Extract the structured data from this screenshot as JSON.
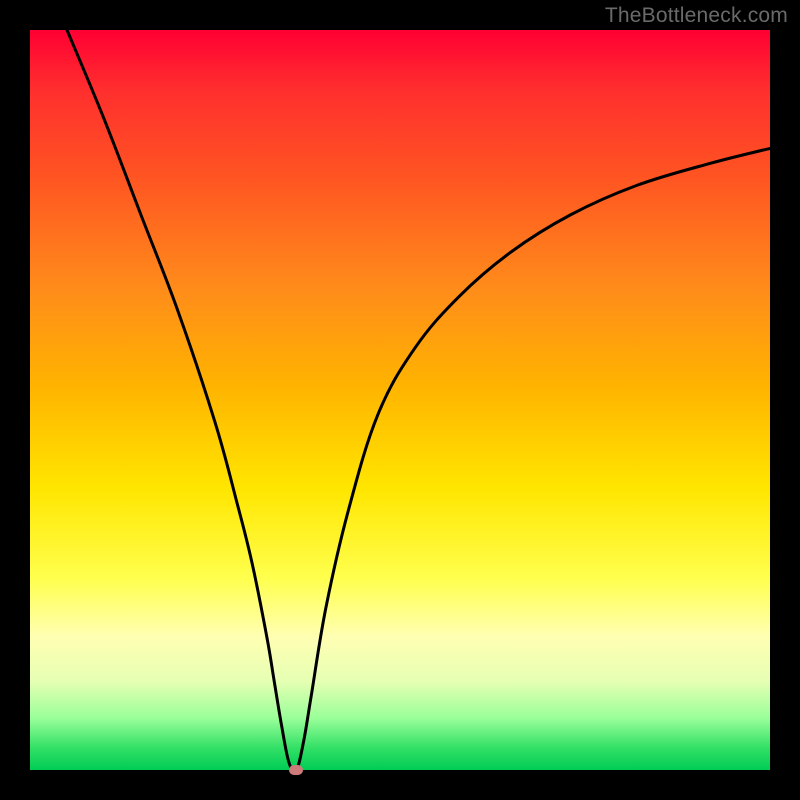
{
  "attribution": "TheBottleneck.com",
  "chart_data": {
    "type": "line",
    "title": "",
    "xlabel": "",
    "ylabel": "",
    "xlim": [
      0,
      100
    ],
    "ylim": [
      0,
      100
    ],
    "series": [
      {
        "name": "bottleneck-curve",
        "x": [
          5,
          10,
          15,
          20,
          25,
          28,
          30,
          32,
          33,
          34,
          35,
          36,
          37,
          38,
          40,
          43,
          47,
          52,
          58,
          65,
          73,
          82,
          92,
          100
        ],
        "values": [
          100,
          88,
          75,
          62,
          47,
          36,
          28,
          18,
          12,
          6,
          1,
          0,
          4,
          10,
          22,
          35,
          48,
          57,
          64,
          70,
          75,
          79,
          82,
          84
        ]
      }
    ],
    "marker": {
      "x": 36,
      "y": 0
    },
    "background_gradient": {
      "stops": [
        {
          "pos": 0,
          "color": "#ff0033"
        },
        {
          "pos": 8,
          "color": "#ff2e2e"
        },
        {
          "pos": 20,
          "color": "#ff5522"
        },
        {
          "pos": 35,
          "color": "#ff8c1a"
        },
        {
          "pos": 48,
          "color": "#ffb300"
        },
        {
          "pos": 62,
          "color": "#ffe600"
        },
        {
          "pos": 74,
          "color": "#ffff4d"
        },
        {
          "pos": 82,
          "color": "#ffffb3"
        },
        {
          "pos": 88,
          "color": "#e6ffb3"
        },
        {
          "pos": 93,
          "color": "#99ff99"
        },
        {
          "pos": 97,
          "color": "#33e066"
        },
        {
          "pos": 100,
          "color": "#00cc55"
        }
      ]
    }
  }
}
